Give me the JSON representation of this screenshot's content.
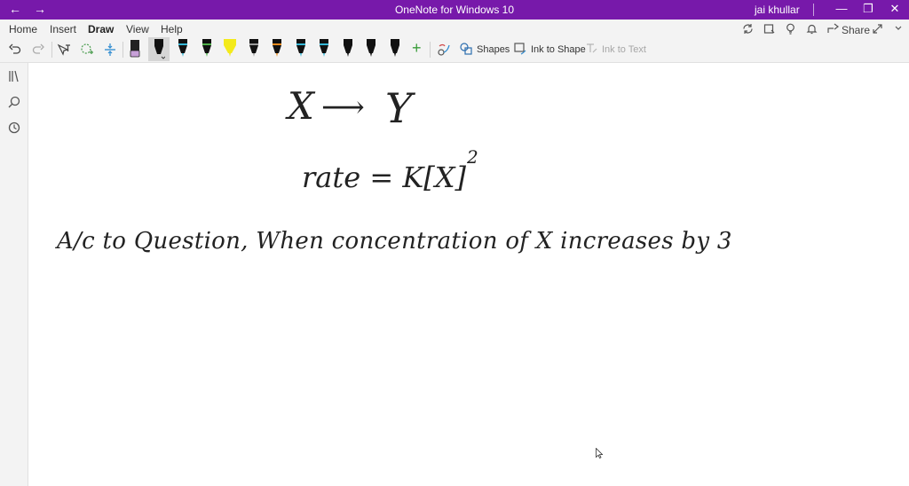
{
  "titlebar": {
    "title": "OneNote for Windows 10",
    "user": "jai khullar",
    "back_glyph": "←",
    "forward_glyph": "→",
    "minimize_glyph": "—",
    "restore_glyph": "❐",
    "close_glyph": "✕"
  },
  "tabs": [
    {
      "label": "Home"
    },
    {
      "label": "Insert"
    },
    {
      "label": "Draw"
    },
    {
      "label": "View"
    },
    {
      "label": "Help"
    }
  ],
  "ribbon_right": {
    "share_label": "Share"
  },
  "toolbar": {
    "shapes_label": "Shapes",
    "ink_to_shape_label": "Ink to Shape",
    "ink_to_text_label": "Ink to Text",
    "add_pen_glyph": "+"
  },
  "pens": [
    {
      "body": "#111111",
      "tip": "#c7a0d8"
    },
    {
      "body": "#111111",
      "tip": "#111111"
    },
    {
      "body": "#111111",
      "tip": "#36b7d6"
    },
    {
      "body": "#111111",
      "tip": "#4fb04a"
    },
    {
      "body": "#f3ea1b",
      "tip": "#f3ea1b"
    },
    {
      "body": "#111111",
      "tip": "#9a9a9a"
    },
    {
      "body": "#111111",
      "tip": "#e68a1e"
    },
    {
      "body": "#111111",
      "tip": "#36b7d6"
    },
    {
      "body": "#111111",
      "tip": "#36b7d6"
    },
    {
      "body": "#111111",
      "tip": "#111111"
    },
    {
      "body": "#111111",
      "tip": "#111111"
    },
    {
      "body": "#111111",
      "tip": "#111111"
    }
  ],
  "colors": {
    "accent": "#7719aa",
    "ribbon_bg": "#f3f3f3"
  },
  "ink": {
    "x_label": "X",
    "arrow": "⟶",
    "y_label": "Y",
    "rate_eq": "rate = K[X]",
    "exponent": "2",
    "sentence": "A/c to Question, When concentration of X increases by 3"
  }
}
